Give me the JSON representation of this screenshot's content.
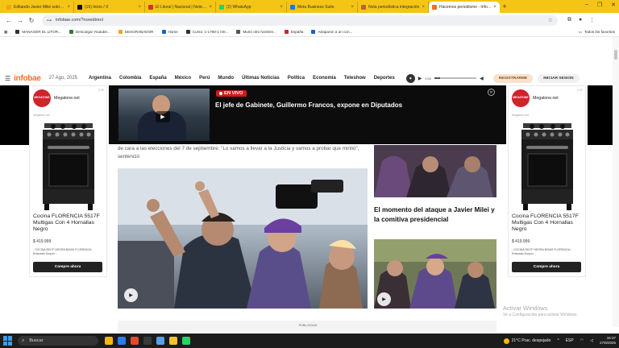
{
  "browser": {
    "tabs": [
      {
        "label": "Editando Javier Milei sobre la...",
        "color": "#f4a21c",
        "active": false
      },
      {
        "label": "(16) Inicio / X",
        "color": "#111111",
        "active": false
      },
      {
        "label": "El Litoral | Nacional | Noticias ...",
        "color": "#d6332b",
        "active": false
      },
      {
        "label": "(2) WhatsApp",
        "color": "#25d366",
        "active": false
      },
      {
        "label": "Meta Business Suite",
        "color": "#1877f2",
        "active": false
      },
      {
        "label": "Nota periodística integración",
        "color": "#c25f2e",
        "active": false
      },
      {
        "label": "Hacemos periodismo - Infobae",
        "color": "#f26f21",
        "active": true
      }
    ],
    "new_tab": "+",
    "url": "infobae.com/?noredirect",
    "window_controls": {
      "minimize": "–",
      "maximize": "❐",
      "close": "✕"
    }
  },
  "bookmarks": {
    "items": [
      {
        "label": "MANAGER EL LITOR...",
        "color": "#333333"
      },
      {
        "label": "Descargar Youtube...",
        "color": "#2e7d32"
      },
      {
        "label": "DESGRABADOR",
        "color": "#f4a21c"
      },
      {
        "label": "Home",
        "color": "#1565c0"
      },
      {
        "label": "Curso: 1-1760-1 Intr...",
        "color": "#333333"
      },
      {
        "label": "Murió otro hombre...",
        "color": "#555555"
      },
      {
        "label": "España",
        "color": "#c62828"
      },
      {
        "label": "Atraparon a un con...",
        "color": "#1565c0"
      }
    ],
    "all": "Todos los favoritos"
  },
  "site": {
    "logo": "infobae",
    "date": "27 Ago, 2025",
    "nav": [
      "Argentina",
      "Colombia",
      "España",
      "México",
      "Perú",
      "Mundo",
      "Últimas Noticias",
      "Política",
      "Economía",
      "Teleshow",
      "Deportes"
    ],
    "player": {
      "time": "0:00",
      "progress": 0.14
    },
    "register": "REGISTRARME",
    "login": "INICIAR SESION"
  },
  "live": {
    "badge": "EN VIVO",
    "headline": "El jefe de Gabinete, Guillermo Francos, expone en Diputados"
  },
  "ad_left": {
    "brand": "Megatone.net",
    "logo_text": "MEGATONE",
    "small": "Megatone.net",
    "title": "Cocina FLORENCIA 5517F Multigas Con 4 Hornallas Negro",
    "price": "$ 419.999",
    "desc": "- COCINA 5517F NEGRA BIGAS FLORENCIA - Enlazado Durpox...",
    "cta": "Compre ahora"
  },
  "ad_right": {
    "brand": "Megatone.net",
    "logo_text": "MEGATONE",
    "small": "Megatone.net",
    "title": "Cocina FLORENCIA 5517F Multigas Con 4 Hornallas Negro",
    "price": "$ 419.999",
    "desc": "- COCINA 5517F NEGRA BIGAS FLORENCIA - Enlazado Durpox...",
    "cta": "Compre ahora"
  },
  "article": {
    "lede": "de cara a las elecciones del 7 de septiembre: \"Lo vamos a llevar a la Justicia y vamos a probar que mintió\", sentenció",
    "side_headline": "El momento del ataque a Javier Milei y la comitiva presidencial",
    "publicidad": "PUBLICIDAD"
  },
  "watermark": {
    "line1": "Activar Windows",
    "line2": "Ve a Configuración para activar Windows."
  },
  "taskbar": {
    "search": "Buscar",
    "weather": "21°C  Prac. despejado",
    "lang": "ESP",
    "time": "16:37",
    "date": "27/8/2025"
  }
}
